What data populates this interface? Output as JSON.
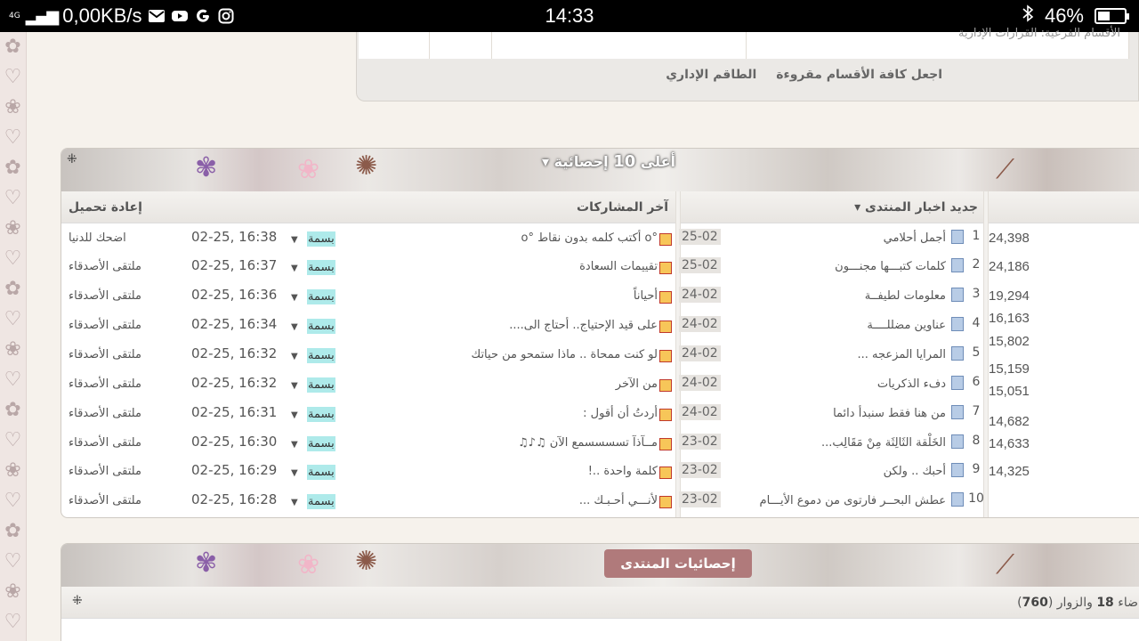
{
  "statusbar": {
    "network": "4G",
    "speed": "0,00KB/s",
    "time": "14:33",
    "battery": "46%",
    "battery_level": 0.46,
    "app_icons": [
      "gmail-icon",
      "youtube-icon",
      "google-icon",
      "instagram-icon"
    ]
  },
  "top_section": {
    "sub_sections_text": "الأقسام الفرعية: القرارات الإدارية",
    "links": [
      "اجعل كافة الأقسام مقروءة",
      "الطاقم الإداري"
    ]
  },
  "top10": {
    "title_prefix": "أعلى",
    "title_number": "10",
    "title_suffix": "إحصائية",
    "col_news": "جديد اخبار المنتدى",
    "col_latest": "آخر المشاركات",
    "col_reload": "إعادة تحميل",
    "rows": [
      {
        "rank": "1",
        "news": "أجمل أحلامي",
        "date": "25-02",
        "post": "°o أكتب كلمه بدون نقاط °o",
        "user": "بسمة",
        "time": "02-25, 16:38",
        "forum": "اضحك للدنيا"
      },
      {
        "rank": "2",
        "news": "كلمات كتبـــها مجنـــون",
        "date": "25-02",
        "post": "تقييمات السعادة",
        "user": "بسمة",
        "time": "02-25, 16:37",
        "forum": "ملتقى الأصدقاء"
      },
      {
        "rank": "3",
        "news": "معلومات لطيفــة",
        "date": "24-02",
        "post": "أحياناً",
        "user": "بسمة",
        "time": "02-25, 16:36",
        "forum": "ملتقى الأصدقاء"
      },
      {
        "rank": "4",
        "news": "عناوين مضللــــة",
        "date": "24-02",
        "post": "على قيد الإحتياج.. أحتاج الى....",
        "user": "بسمة",
        "time": "02-25, 16:34",
        "forum": "ملتقى الأصدقاء"
      },
      {
        "rank": "5",
        "news": "المرايا المزعجه ...",
        "date": "24-02",
        "post": "لو كنت ممحاة .. ماذا ستمحو من حياتك",
        "user": "بسمة",
        "time": "02-25, 16:32",
        "forum": "ملتقى الأصدقاء"
      },
      {
        "rank": "6",
        "news": "دفء الذكريات",
        "date": "24-02",
        "post": "من الآخر",
        "user": "بسمة",
        "time": "02-25, 16:32",
        "forum": "ملتقى الأصدقاء"
      },
      {
        "rank": "7",
        "news": "من هنا فقط سنبدأ دائما",
        "date": "24-02",
        "post": "أردتُ أن أقول :",
        "user": "بسمة",
        "time": "02-25, 16:31",
        "forum": "ملتقى الأصدقاء"
      },
      {
        "rank": "8",
        "news": "الخَلْقة الثَالِثَة مِنْ مَقَالِب...",
        "date": "23-02",
        "post": "مــآذآ تسسسسمع الآن ♫♪♫",
        "user": "بسمة",
        "time": "02-25, 16:30",
        "forum": "ملتقى الأصدقاء"
      },
      {
        "rank": "9",
        "news": "أحبك .. ولكن",
        "date": "23-02",
        "post": "كلمة واحدة ..!",
        "user": "بسمة",
        "time": "02-25, 16:29",
        "forum": "ملتقى الأصدقاء"
      },
      {
        "rank": "10",
        "news": "عطش البحــر فارتوى من دموع الأيـــام",
        "date": "23-02",
        "post": "لأنـــي أحـبـك ...",
        "user": "بسمة",
        "time": "02-25, 16:28",
        "forum": "ملتقى الأصدقاء"
      }
    ],
    "numbers": [
      "24,398",
      "24,186",
      "19,294",
      "16,163",
      "15,802",
      "15,159",
      "15,051",
      "14,682",
      "14,633",
      "14,325"
    ]
  },
  "forum_stats": {
    "title": "إحصائيات المنتدى",
    "text_start": "ضاء",
    "members_count": "18",
    "text_mid": "والزوار",
    "visitors_count": "760"
  }
}
